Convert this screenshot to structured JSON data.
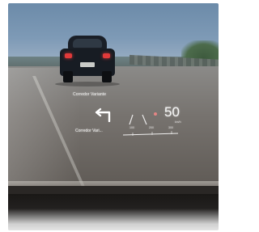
{
  "hud": {
    "street_top": "Corredor Variante",
    "street_bottom": "Corredor Vari...",
    "speed": "50",
    "speed_unit": "km/h",
    "distance_ticks": [
      "100",
      "200",
      "300"
    ],
    "turn_icon": "turn-left-arrow-icon"
  },
  "colors": {
    "hud_text": "#ffffff",
    "tail_light": "#e03a3a",
    "sky": "#7e9ab6",
    "road": "#77736f",
    "dashboard": "#1f1d1b"
  }
}
